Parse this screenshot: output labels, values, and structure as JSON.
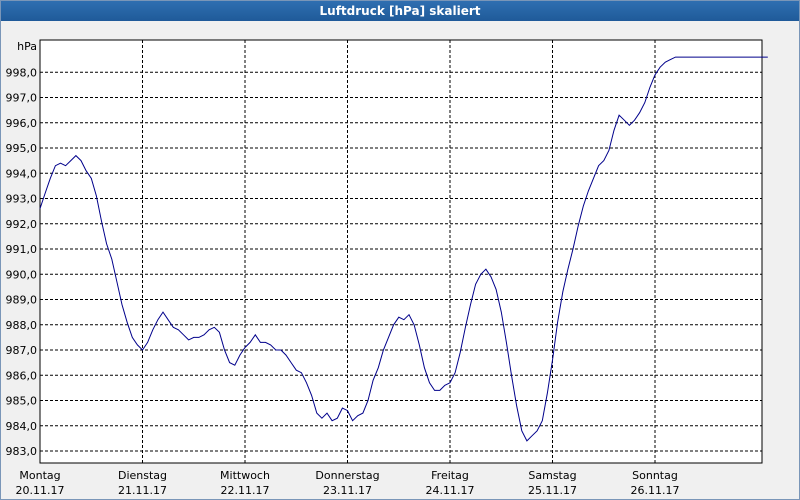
{
  "window": {
    "title": "Luftdruck [hPa] skaliert"
  },
  "chart_data": {
    "type": "line",
    "title": "Luftdruck [hPa] skaliert",
    "ylabel": "hPa",
    "xlabel": "",
    "ylim": [
      983.0,
      999.0
    ],
    "xlim": [
      0,
      7.1
    ],
    "grid": true,
    "y_ticks": [
      "983,0",
      "984,0",
      "985,0",
      "986,0",
      "987,0",
      "988,0",
      "989,0",
      "990,0",
      "991,0",
      "992,0",
      "993,0",
      "994,0",
      "995,0",
      "996,0",
      "997,0",
      "998,0"
    ],
    "x_ticks": [
      {
        "day": "Montag",
        "date": "20.11.17"
      },
      {
        "day": "Dienstag",
        "date": "21.11.17"
      },
      {
        "day": "Mittwoch",
        "date": "22.11.17"
      },
      {
        "day": "Donnerstag",
        "date": "23.11.17"
      },
      {
        "day": "Freitag",
        "date": "24.11.17"
      },
      {
        "day": "Samstag",
        "date": "25.11.17"
      },
      {
        "day": "Sonntag",
        "date": "26.11.17"
      }
    ],
    "series": [
      {
        "color": "#00008b",
        "x": [
          0.0,
          0.05,
          0.1,
          0.15,
          0.2,
          0.25,
          0.3,
          0.35,
          0.4,
          0.45,
          0.5,
          0.55,
          0.6,
          0.65,
          0.7,
          0.75,
          0.8,
          0.85,
          0.9,
          0.95,
          1.0,
          1.05,
          1.1,
          1.15,
          1.2,
          1.25,
          1.3,
          1.35,
          1.4,
          1.45,
          1.5,
          1.55,
          1.6,
          1.65,
          1.7,
          1.75,
          1.8,
          1.85,
          1.9,
          1.95,
          2.0,
          2.05,
          2.1,
          2.15,
          2.2,
          2.25,
          2.3,
          2.35,
          2.4,
          2.45,
          2.5,
          2.55,
          2.6,
          2.65,
          2.7,
          2.75,
          2.8,
          2.85,
          2.9,
          2.95,
          3.0,
          3.05,
          3.1,
          3.15,
          3.2,
          3.25,
          3.3,
          3.35,
          3.4,
          3.45,
          3.5,
          3.55,
          3.6,
          3.65,
          3.7,
          3.75,
          3.8,
          3.85,
          3.9,
          3.95,
          4.0,
          4.05,
          4.1,
          4.15,
          4.2,
          4.25,
          4.3,
          4.35,
          4.4,
          4.45,
          4.5,
          4.55,
          4.6,
          4.65,
          4.7,
          4.75,
          4.8,
          4.85,
          4.9,
          4.95,
          5.0,
          5.05,
          5.1,
          5.15,
          5.2,
          5.25,
          5.3,
          5.35,
          5.4,
          5.45,
          5.5,
          5.55,
          5.6,
          5.65,
          5.7,
          5.75,
          5.8,
          5.85,
          5.9,
          5.95,
          6.0,
          6.05,
          6.1,
          6.15,
          6.2,
          6.25,
          6.3,
          6.35,
          6.4,
          6.45,
          6.5,
          6.55,
          6.6,
          6.65,
          6.7,
          6.75,
          6.8,
          6.85,
          6.9,
          6.95,
          7.0,
          7.05,
          7.1
        ],
        "y": [
          992.6,
          993.2,
          993.8,
          994.3,
          994.4,
          994.3,
          994.5,
          994.7,
          994.5,
          994.1,
          993.8,
          993.1,
          992.1,
          991.2,
          990.6,
          989.7,
          988.8,
          988.1,
          987.5,
          987.2,
          987.0,
          987.3,
          987.8,
          988.2,
          988.5,
          988.2,
          987.9,
          987.8,
          987.6,
          987.4,
          987.5,
          987.5,
          987.6,
          987.8,
          987.9,
          987.7,
          987.0,
          986.5,
          986.4,
          986.8,
          987.1,
          987.3,
          987.6,
          987.3,
          987.3,
          987.2,
          987.0,
          987.0,
          986.8,
          986.5,
          986.2,
          986.1,
          985.7,
          985.2,
          984.5,
          984.3,
          984.5,
          984.2,
          984.3,
          984.7,
          984.6,
          984.2,
          984.4,
          984.5,
          985.0,
          985.8,
          986.3,
          987.0,
          987.5,
          988.0,
          988.3,
          988.2,
          988.4,
          988.0,
          987.2,
          986.3,
          985.7,
          985.4,
          985.4,
          985.6,
          985.7,
          986.1,
          986.9,
          987.9,
          988.8,
          989.6,
          990.0,
          990.2,
          989.9,
          989.4,
          988.5,
          987.3,
          986.0,
          984.8,
          983.8,
          983.4,
          983.6,
          983.8,
          984.2,
          985.3,
          986.6,
          988.1,
          989.3,
          990.2,
          991.0,
          991.9,
          992.7,
          993.3,
          993.8,
          994.3,
          994.5,
          994.9,
          995.7,
          996.3,
          996.1,
          995.9,
          996.1,
          996.4,
          996.8,
          997.4,
          997.9,
          998.2,
          998.4,
          998.5,
          998.6,
          998.6,
          998.6,
          998.6,
          998.6,
          998.6,
          998.6,
          998.6,
          998.6,
          998.6,
          998.6,
          998.6,
          998.6,
          998.6,
          998.6,
          998.6,
          998.6,
          998.6,
          998.6
        ]
      }
    ]
  }
}
